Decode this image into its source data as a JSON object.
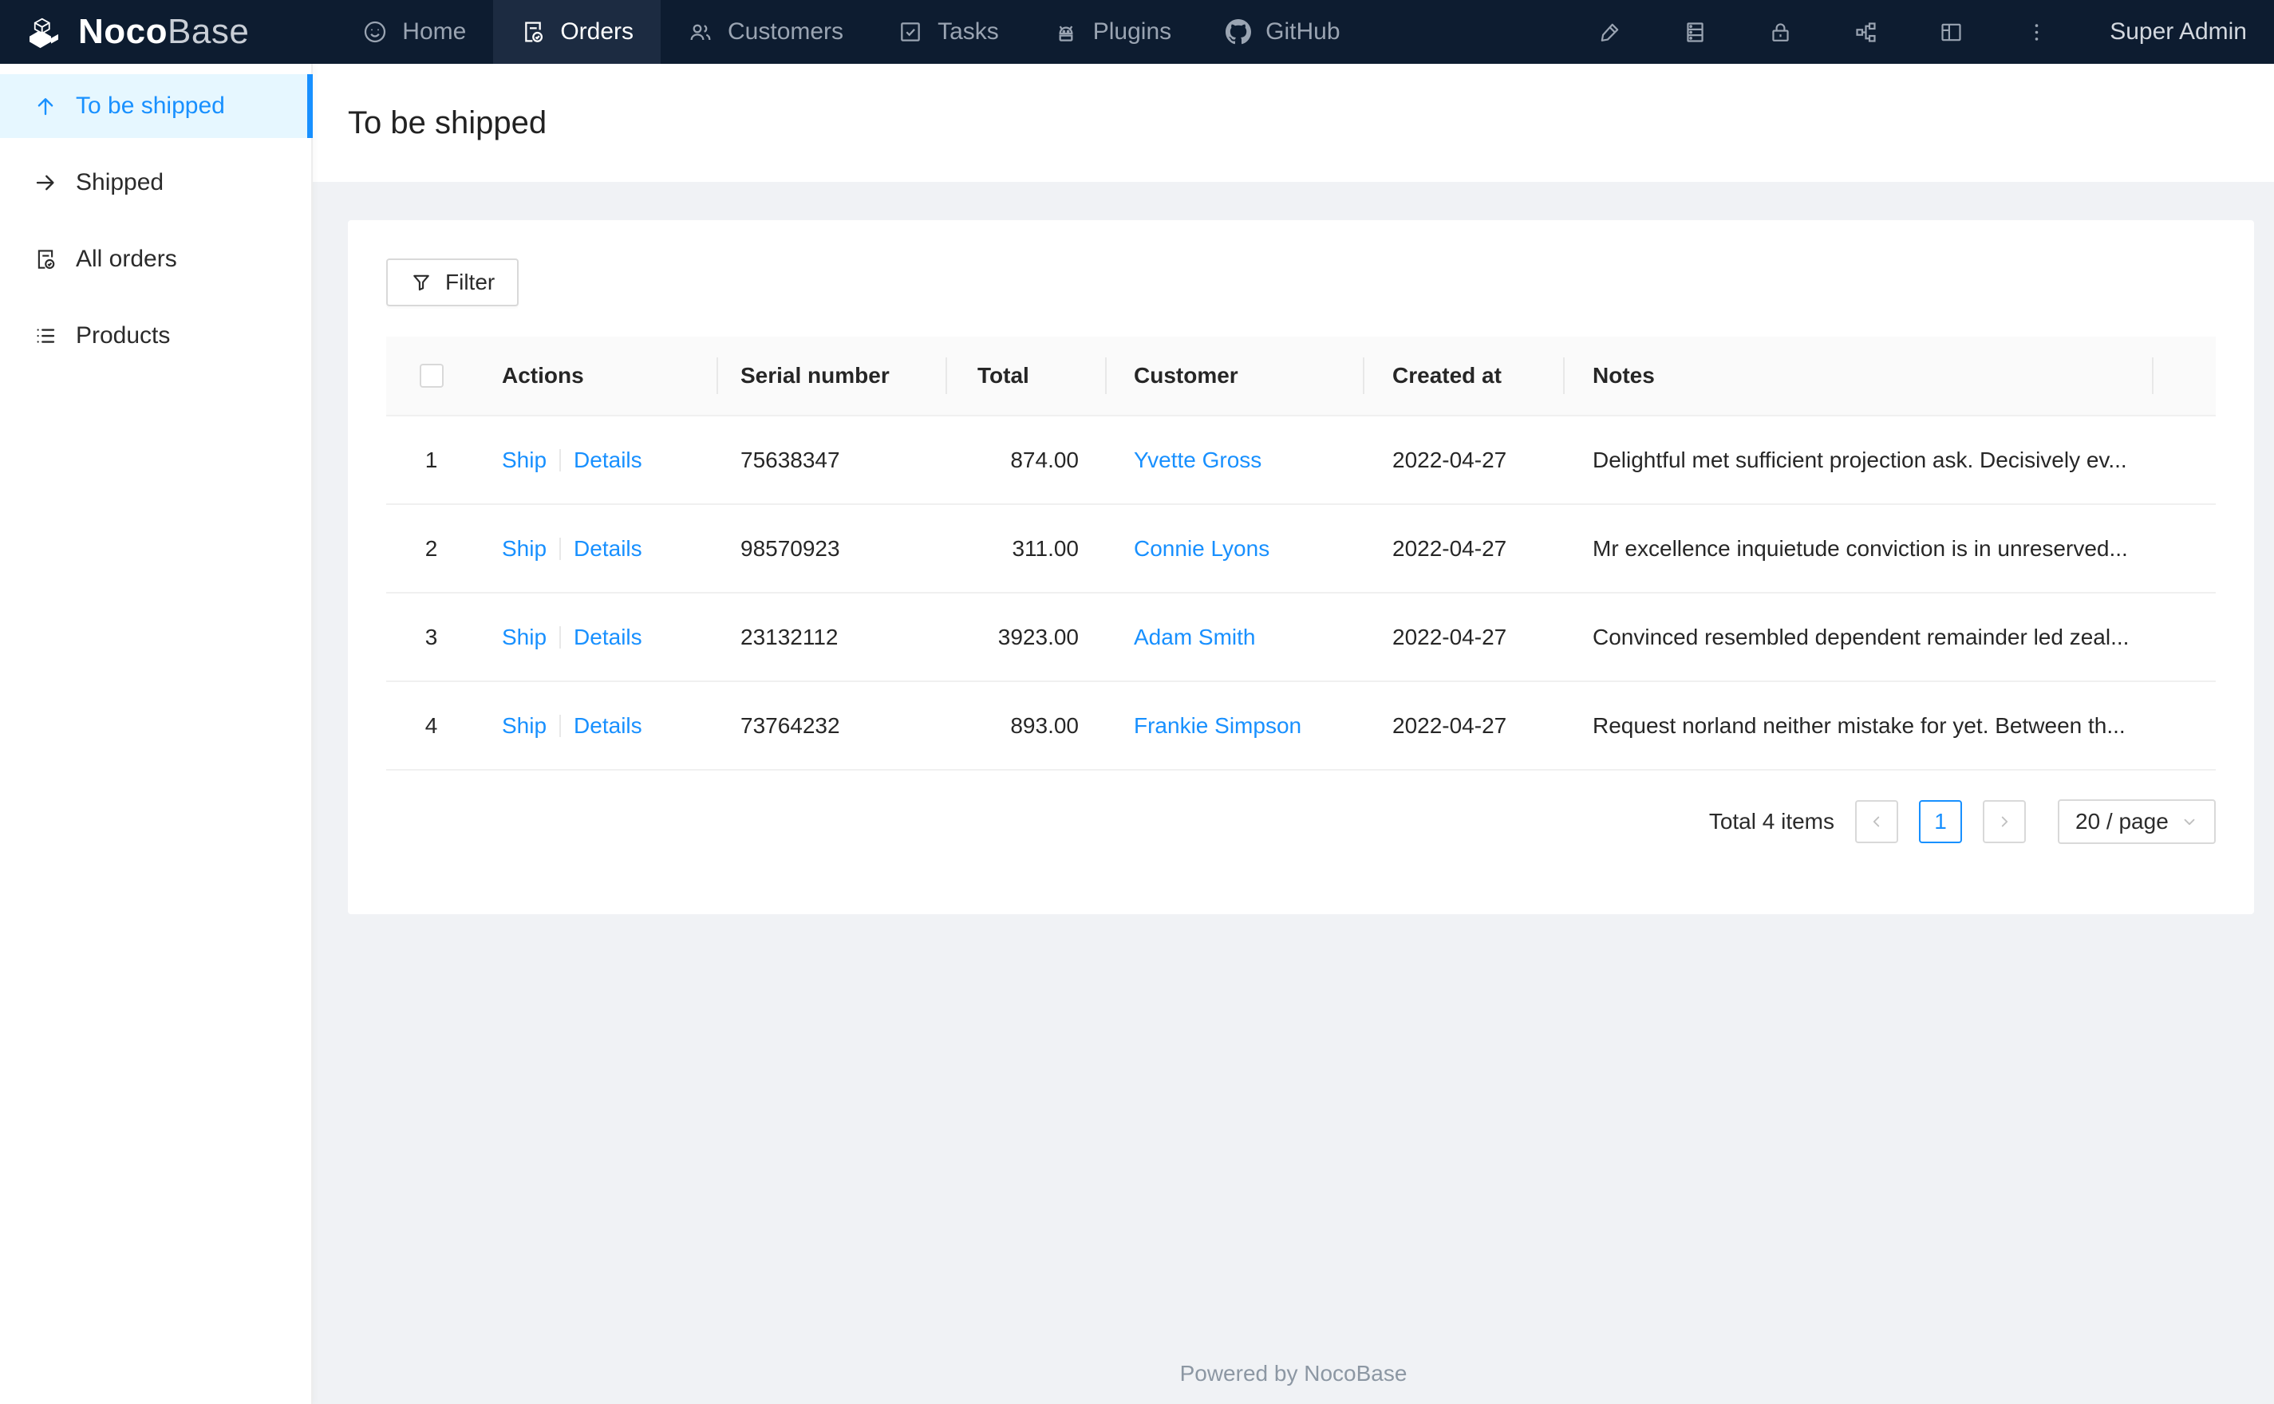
{
  "navbar": {
    "brand": {
      "bold": "Noco",
      "light": "Base"
    },
    "items": [
      {
        "label": "Home",
        "icon": "smile-icon",
        "active": false
      },
      {
        "label": "Orders",
        "icon": "file-done-icon",
        "active": true
      },
      {
        "label": "Customers",
        "icon": "team-icon",
        "active": false
      },
      {
        "label": "Tasks",
        "icon": "check-square-icon",
        "active": false
      },
      {
        "label": "Plugins",
        "icon": "android-icon",
        "active": false
      },
      {
        "label": "GitHub",
        "icon": "github-icon",
        "active": false
      }
    ],
    "tool_icons": [
      "highlighter-icon",
      "database-icon",
      "lock-icon",
      "apartment-icon",
      "layout-icon",
      "more-icon"
    ],
    "user": "Super Admin"
  },
  "sidebar": {
    "items": [
      {
        "label": "To be shipped",
        "icon": "arrow-up-icon",
        "active": true
      },
      {
        "label": "Shipped",
        "icon": "arrow-right-icon",
        "active": false
      },
      {
        "label": "All orders",
        "icon": "file-done-icon",
        "active": false
      },
      {
        "label": "Products",
        "icon": "unordered-list-icon",
        "active": false
      }
    ]
  },
  "page": {
    "title": "To be shipped"
  },
  "toolbar": {
    "filter_label": "Filter"
  },
  "table": {
    "columns": [
      "Actions",
      "Serial number",
      "Total",
      "Customer",
      "Created at",
      "Notes"
    ],
    "actions": {
      "ship": "Ship",
      "details": "Details"
    },
    "rows": [
      {
        "index": "1",
        "serial": "75638347",
        "total": "874.00",
        "customer": "Yvette Gross",
        "created_at": "2022-04-27",
        "notes": "Delightful met sufficient projection ask. Decisively ev..."
      },
      {
        "index": "2",
        "serial": "98570923",
        "total": "311.00",
        "customer": "Connie Lyons",
        "created_at": "2022-04-27",
        "notes": "Mr excellence inquietude conviction is in unreserved..."
      },
      {
        "index": "3",
        "serial": "23132112",
        "total": "3923.00",
        "customer": "Adam Smith",
        "created_at": "2022-04-27",
        "notes": "Convinced resembled dependent remainder led zeal..."
      },
      {
        "index": "4",
        "serial": "73764232",
        "total": "893.00",
        "customer": "Frankie Simpson",
        "created_at": "2022-04-27",
        "notes": "Request norland neither mistake for yet. Between th..."
      }
    ]
  },
  "pagination": {
    "total_text": "Total 4 items",
    "current_page": "1",
    "page_size": "20 / page"
  },
  "footer": {
    "text": "Powered by NocoBase"
  },
  "colors": {
    "accent": "#1890ff",
    "navbar_bg": "#0d1c30",
    "navbar_active_bg": "#1c2b41",
    "sidebar_active_bg": "#e6f7ff",
    "content_bg": "#f0f2f5",
    "table_header_bg": "#fafafa",
    "border": "#f0f0f0"
  }
}
